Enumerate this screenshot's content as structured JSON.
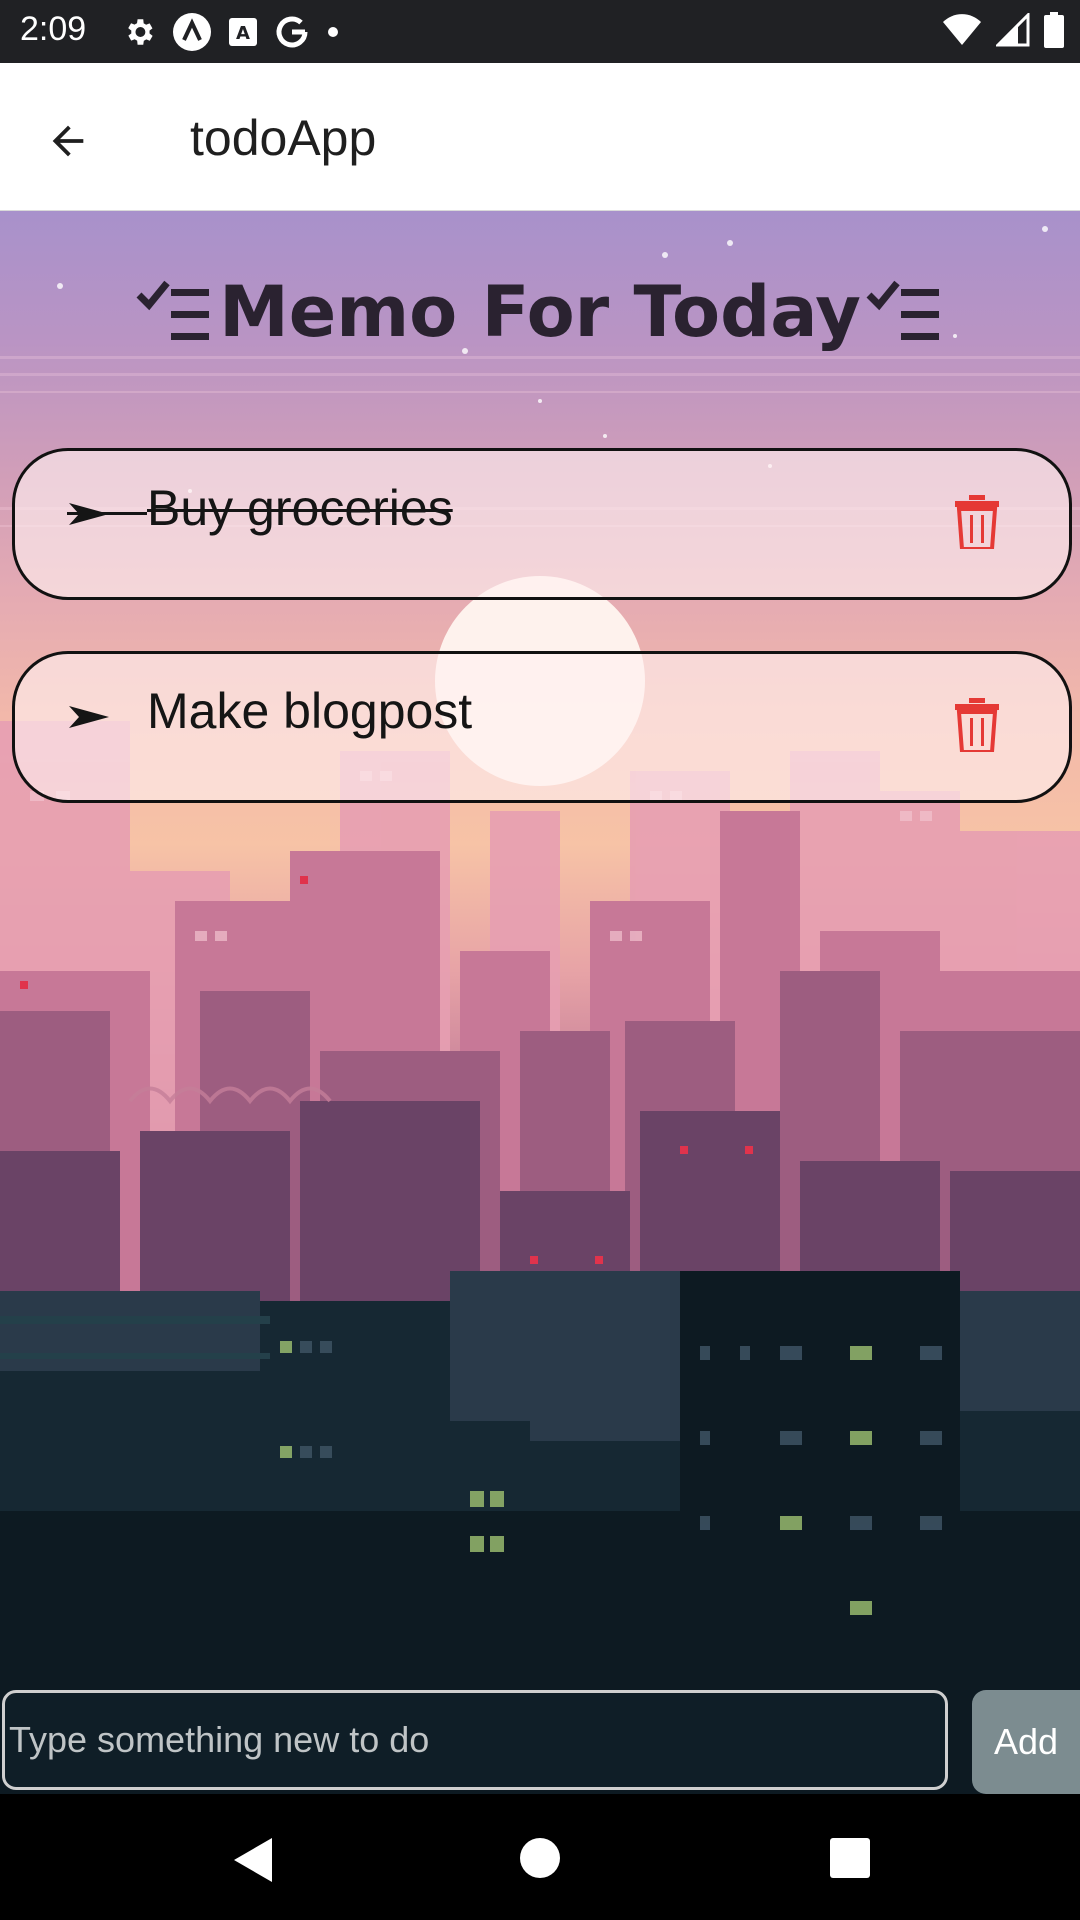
{
  "status_bar": {
    "time": "2:09",
    "left_icons": [
      "gear-icon",
      "a-badge-icon",
      "a-square-icon",
      "google-g-icon",
      "dot-icon"
    ],
    "right_icons": [
      "wifi-icon",
      "signal-icon",
      "battery-icon"
    ]
  },
  "app_bar": {
    "title": "todoApp",
    "back_icon": "arrow-left-icon"
  },
  "main": {
    "heading": "Memo For Today",
    "heading_icon": "checklist-icon",
    "todos": [
      {
        "text": "Buy groceries",
        "completed": true,
        "bullet_icon": "arrow-bullet-icon",
        "delete_icon": "trash-icon"
      },
      {
        "text": "Make blogpost",
        "completed": false,
        "bullet_icon": "arrow-bullet-icon",
        "delete_icon": "trash-icon"
      }
    ]
  },
  "composer": {
    "placeholder": "Type something new to do",
    "value": "",
    "add_label": "Add"
  },
  "colors": {
    "delete": "#e53935",
    "heading": "#2a2230",
    "card_border": "#111111"
  },
  "nav_bar": {
    "icons": [
      "nav-back-icon",
      "nav-home-icon",
      "nav-recents-icon"
    ]
  }
}
